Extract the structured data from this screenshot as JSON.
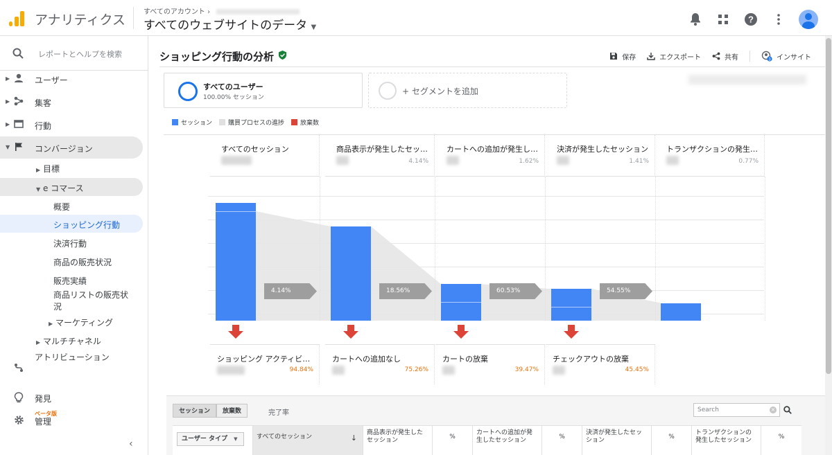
{
  "header": {
    "app_title": "アナリティクス",
    "breadcrumb": "すべてのアカウント",
    "property_view": "すべてのウェブサイトのデータ",
    "icons": [
      "bell-icon",
      "apps-grid-icon",
      "help-icon",
      "more-vert-icon",
      "account-avatar"
    ]
  },
  "sidebar": {
    "search_placeholder": "レポートとヘルプを検索",
    "items": [
      {
        "label": "ユーザー"
      },
      {
        "label": "集客"
      },
      {
        "label": "行動"
      },
      {
        "label": "コンバージョン"
      }
    ],
    "conversion_children": {
      "goals": "目標",
      "ecommerce": "e コマース",
      "ecommerce_children": [
        "概要",
        "ショッピング行動",
        "決済行動",
        "商品の販売状況",
        "販売実績",
        "商品リストの販売状況"
      ],
      "marketing": "マーケティング",
      "multichannel": "マルチチャネル"
    },
    "attribution": "アトリビューション",
    "beta": "ベータ版",
    "discover": "発見",
    "admin": "管理"
  },
  "report": {
    "title": "ショッピング行動の分析",
    "actions": {
      "save": "保存",
      "export": "エクスポート",
      "share": "共有",
      "insights": "インサイト"
    },
    "segment": {
      "name": "すべてのユーザー",
      "sub": "100.00% セッション"
    },
    "add_segment": "+ セグメントを追加",
    "legend": [
      {
        "label": "セッション",
        "color": "#4285f4"
      },
      {
        "label": "購買プロセスの進捗",
        "color": "#e0e0e0"
      },
      {
        "label": "放棄数",
        "color": "#db4437"
      }
    ]
  },
  "chart_data": {
    "type": "bar",
    "categories": [
      "すべてのセッション",
      "商品表示が発生したセッション",
      "カートへの追加が発生したセッション",
      "決済が発生したセッション",
      "トランザクションの発生したセッション"
    ],
    "step_percent_of_all": [
      "",
      "4.14%",
      "1.62%",
      "1.41%",
      "0.77%"
    ],
    "relative_heights": [
      1.0,
      0.8,
      0.31,
      0.27,
      0.15
    ],
    "progress_tags": [
      "4.14%",
      "18.56%",
      "60.53%",
      "54.55%"
    ],
    "abandonments": [
      {
        "label": "ショッピング アクティビティなし",
        "percent": "94.84%"
      },
      {
        "label": "カートへの追加なし",
        "percent": "75.26%"
      },
      {
        "label": "カートの放棄",
        "percent": "39.47%"
      },
      {
        "label": "チェックアウトの放棄",
        "percent": "45.45%"
      }
    ],
    "colors": {
      "session": "#4285f4",
      "progress": "#e8e8e8",
      "abandon": "#db4437"
    }
  },
  "table": {
    "tabs": [
      "セッション",
      "放棄数"
    ],
    "tab_plain": "完了率",
    "search_placeholder": "Search",
    "dimension": "ユーザー タイプ",
    "columns": [
      "すべてのセッション",
      "商品表示が発生したセッション",
      "%",
      "カートへの追加が発生したセッション",
      "%",
      "決済が発生したセッション",
      "%",
      "トランザクションの発生したセッション",
      "%"
    ]
  }
}
